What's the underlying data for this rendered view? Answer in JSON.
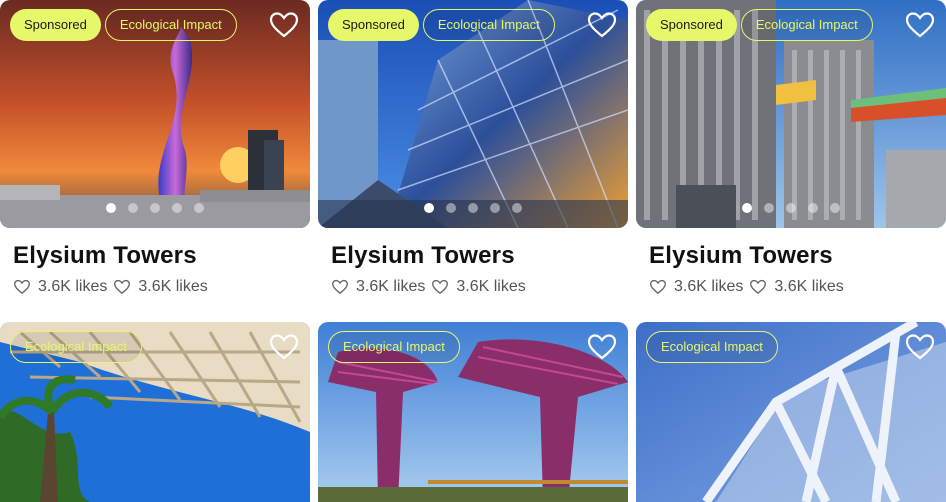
{
  "cards": [
    {
      "title": "Elysium Towers",
      "sponsored": "Sponsored",
      "eco": "Ecological Impact",
      "likes": [
        "3.6K likes",
        "3.6K likes"
      ],
      "heart_icon": "heart-outline-icon"
    },
    {
      "title": "Elysium Towers",
      "sponsored": "Sponsored",
      "eco": "Ecological Impact",
      "likes": [
        "3.6K likes",
        "3.6K likes"
      ],
      "heart_icon": "heart-outline-icon"
    },
    {
      "title": "Elysium Towers",
      "sponsored": "Sponsored",
      "eco": "Ecological Impact",
      "likes": [
        "3.6K likes",
        "3.6K likes"
      ],
      "heart_icon": "heart-outline-icon"
    },
    {
      "eco": "Ecological Impact",
      "heart_icon": "heart-outline-icon"
    },
    {
      "eco": "Ecological Impact",
      "heart_icon": "heart-outline-icon"
    },
    {
      "eco": "Ecological Impact",
      "heart_icon": "heart-outline-icon"
    }
  ],
  "carousel": {
    "total_slides": 5,
    "active_slide": 1
  },
  "colors": {
    "badge_accent": "#e6f76a",
    "title": "#111111",
    "likes_text": "#555555"
  }
}
